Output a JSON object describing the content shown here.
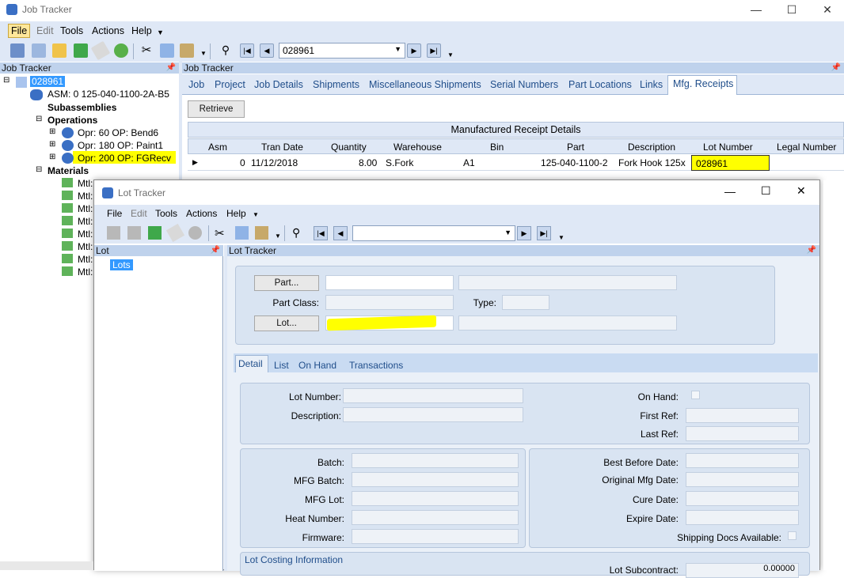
{
  "main_window": {
    "title": "Job Tracker",
    "menu": [
      "File",
      "Edit",
      "Tools",
      "Actions",
      "Help"
    ],
    "job_combo": "028961",
    "left_panel_title": "Job Tracker",
    "right_panel_title": "Job Tracker",
    "tree": {
      "root": "028961",
      "asm": "ASM: 0 125-040-1100-2A-B5",
      "subassemblies": "Subassemblies",
      "operations": "Operations",
      "ops": [
        "Opr: 60 OP: Bend6",
        "Opr: 180 OP: Paint1",
        "Opr: 200 OP: FGRecv"
      ],
      "materials": "Materials",
      "mtl": [
        "Mtl:",
        "Mtl:",
        "Mtl:",
        "Mtl:",
        "Mtl:",
        "Mtl:",
        "Mtl:",
        "Mtl:"
      ]
    },
    "tabs": [
      "Job",
      "Project",
      "Job Details",
      "Shipments",
      "Miscellaneous Shipments",
      "Serial Numbers",
      "Part Locations",
      "Links",
      "Mfg. Receipts"
    ],
    "retrieve_label": "Retrieve",
    "grid_title": "Manufactured Receipt Details",
    "grid_columns": [
      "Asm",
      "Tran Date",
      "Quantity",
      "Warehouse",
      "Bin",
      "Part",
      "Description",
      "Lot Number",
      "Legal Number"
    ],
    "grid_row": {
      "asm": "0",
      "tran_date": "11/12/2018",
      "quantity": "8.00",
      "warehouse": "S.Fork",
      "bin": "A1",
      "part": "125-040-1100-2",
      "description": "Fork Hook 125x",
      "lot_number": "028961",
      "legal_number": ""
    }
  },
  "lot_window": {
    "title": "Lot Tracker",
    "menu": [
      "File",
      "Edit",
      "Tools",
      "Actions",
      "Help"
    ],
    "left_panel_title": "Lot",
    "tree_item": "Lots",
    "right_panel_title": "Lot Tracker",
    "part_btn": "Part...",
    "part_class_label": "Part Class:",
    "type_label": "Type:",
    "lot_btn": "Lot...",
    "tabs": [
      "Detail",
      "List",
      "On Hand",
      "Transactions"
    ],
    "lot_number_label": "Lot Number:",
    "description_label": "Description:",
    "on_hand_label": "On Hand:",
    "first_ref_label": "First Ref:",
    "last_ref_label": "Last Ref:",
    "batch_label": "Batch:",
    "mfg_batch_label": "MFG Batch:",
    "mfg_lot_label": "MFG Lot:",
    "heat_number_label": "Heat Number:",
    "firmware_label": "Firmware:",
    "best_before_label": "Best Before Date:",
    "orig_mfg_label": "Original Mfg Date:",
    "cure_date_label": "Cure Date:",
    "expire_date_label": "Expire Date:",
    "shipping_docs_label": "Shipping Docs Available:",
    "lot_costing_label": "Lot Costing Information",
    "lot_subcontract_label": "Lot Subcontract:",
    "lot_subcontract_value": "0.00000"
  },
  "colors": {
    "highlight": "#ffff00",
    "selected": "#3399ff",
    "menu_bg": "#dfe8f6",
    "panel_header": "#bfd2ec"
  }
}
